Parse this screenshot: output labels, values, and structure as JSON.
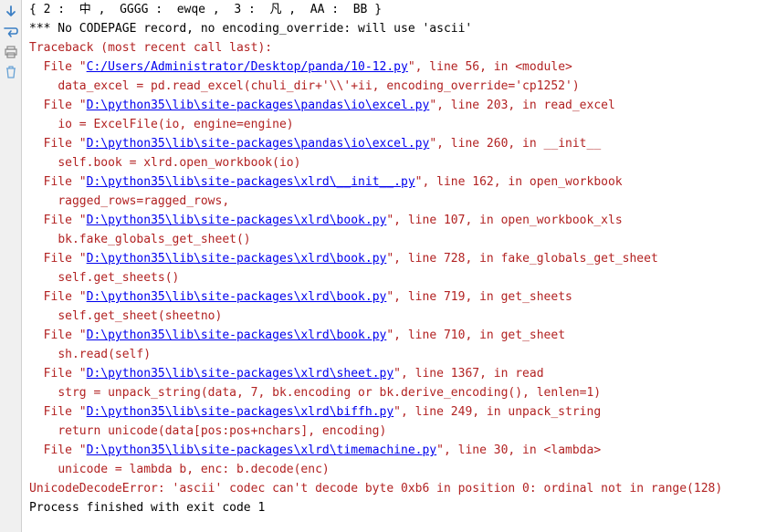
{
  "icons": {
    "down": "down-arrow-icon",
    "wrap": "wrap-icon",
    "print": "print-icon",
    "trash": "trash-icon"
  },
  "lines": [
    {
      "indent": "",
      "parts": [
        {
          "t": "{ 2 :  中 ,  GGGG :  ewqe ,  3 :  凡 ,  AA :  BB }",
          "c": ""
        }
      ]
    },
    {
      "indent": "",
      "parts": [
        {
          "t": "*** No CODEPAGE record, no encoding_override: will use 'ascii'",
          "c": ""
        }
      ]
    },
    {
      "indent": "",
      "parts": [
        {
          "t": "Traceback (most recent call last):",
          "c": "red"
        }
      ]
    },
    {
      "indent": "  ",
      "parts": [
        {
          "t": "File \"",
          "c": "red"
        },
        {
          "t": "C:/Users/Administrator/Desktop/panda/10-12.py",
          "c": "blue"
        },
        {
          "t": "\", line 56, in <module>",
          "c": "red"
        }
      ]
    },
    {
      "indent": "    ",
      "parts": [
        {
          "t": "data_excel = pd.read_excel(chuli_dir+'\\\\'+ii, encoding_override='cp1252')",
          "c": "red"
        }
      ]
    },
    {
      "indent": "  ",
      "parts": [
        {
          "t": "File \"",
          "c": "red"
        },
        {
          "t": "D:\\python35\\lib\\site-packages\\pandas\\io\\excel.py",
          "c": "blue"
        },
        {
          "t": "\", line 203, in read_excel",
          "c": "red"
        }
      ]
    },
    {
      "indent": "    ",
      "parts": [
        {
          "t": "io = ExcelFile(io, engine=engine)",
          "c": "red"
        }
      ]
    },
    {
      "indent": "  ",
      "parts": [
        {
          "t": "File \"",
          "c": "red"
        },
        {
          "t": "D:\\python35\\lib\\site-packages\\pandas\\io\\excel.py",
          "c": "blue"
        },
        {
          "t": "\", line 260, in __init__",
          "c": "red"
        }
      ]
    },
    {
      "indent": "    ",
      "parts": [
        {
          "t": "self.book = xlrd.open_workbook(io)",
          "c": "red"
        }
      ]
    },
    {
      "indent": "  ",
      "parts": [
        {
          "t": "File \"",
          "c": "red"
        },
        {
          "t": "D:\\python35\\lib\\site-packages\\xlrd\\__init__.py",
          "c": "blue"
        },
        {
          "t": "\", line 162, in open_workbook",
          "c": "red"
        }
      ]
    },
    {
      "indent": "    ",
      "parts": [
        {
          "t": "ragged_rows=ragged_rows,",
          "c": "red"
        }
      ]
    },
    {
      "indent": "  ",
      "parts": [
        {
          "t": "File \"",
          "c": "red"
        },
        {
          "t": "D:\\python35\\lib\\site-packages\\xlrd\\book.py",
          "c": "blue"
        },
        {
          "t": "\", line 107, in open_workbook_xls",
          "c": "red"
        }
      ]
    },
    {
      "indent": "    ",
      "parts": [
        {
          "t": "bk.fake_globals_get_sheet()",
          "c": "red"
        }
      ]
    },
    {
      "indent": "  ",
      "parts": [
        {
          "t": "File \"",
          "c": "red"
        },
        {
          "t": "D:\\python35\\lib\\site-packages\\xlrd\\book.py",
          "c": "blue"
        },
        {
          "t": "\", line 728, in fake_globals_get_sheet",
          "c": "red"
        }
      ]
    },
    {
      "indent": "    ",
      "parts": [
        {
          "t": "self.get_sheets()",
          "c": "red"
        }
      ]
    },
    {
      "indent": "  ",
      "parts": [
        {
          "t": "File \"",
          "c": "red"
        },
        {
          "t": "D:\\python35\\lib\\site-packages\\xlrd\\book.py",
          "c": "blue"
        },
        {
          "t": "\", line 719, in get_sheets",
          "c": "red"
        }
      ]
    },
    {
      "indent": "    ",
      "parts": [
        {
          "t": "self.get_sheet(sheetno)",
          "c": "red"
        }
      ]
    },
    {
      "indent": "  ",
      "parts": [
        {
          "t": "File \"",
          "c": "red"
        },
        {
          "t": "D:\\python35\\lib\\site-packages\\xlrd\\book.py",
          "c": "blue"
        },
        {
          "t": "\", line 710, in get_sheet",
          "c": "red"
        }
      ]
    },
    {
      "indent": "    ",
      "parts": [
        {
          "t": "sh.read(self)",
          "c": "red"
        }
      ]
    },
    {
      "indent": "  ",
      "parts": [
        {
          "t": "File \"",
          "c": "red"
        },
        {
          "t": "D:\\python35\\lib\\site-packages\\xlrd\\sheet.py",
          "c": "blue"
        },
        {
          "t": "\", line 1367, in read",
          "c": "red"
        }
      ]
    },
    {
      "indent": "    ",
      "parts": [
        {
          "t": "strg = unpack_string(data, 7, bk.encoding or bk.derive_encoding(), lenlen=1)",
          "c": "red"
        }
      ]
    },
    {
      "indent": "  ",
      "parts": [
        {
          "t": "File \"",
          "c": "red"
        },
        {
          "t": "D:\\python35\\lib\\site-packages\\xlrd\\biffh.py",
          "c": "blue"
        },
        {
          "t": "\", line 249, in unpack_string",
          "c": "red"
        }
      ]
    },
    {
      "indent": "    ",
      "parts": [
        {
          "t": "return unicode(data[pos:pos+nchars], encoding)",
          "c": "red"
        }
      ]
    },
    {
      "indent": "  ",
      "parts": [
        {
          "t": "File \"",
          "c": "red"
        },
        {
          "t": "D:\\python35\\lib\\site-packages\\xlrd\\timemachine.py",
          "c": "blue"
        },
        {
          "t": "\", line 30, in <lambda>",
          "c": "red"
        }
      ]
    },
    {
      "indent": "    ",
      "parts": [
        {
          "t": "unicode = lambda b, enc: b.decode(enc)",
          "c": "red"
        }
      ]
    },
    {
      "indent": "",
      "parts": [
        {
          "t": "UnicodeDecodeError: 'ascii' codec can't decode byte 0xb6 in position 0: ordinal not in range(128)",
          "c": "red"
        }
      ]
    },
    {
      "indent": "",
      "parts": [
        {
          "t": "",
          "c": ""
        }
      ]
    },
    {
      "indent": "",
      "parts": [
        {
          "t": "Process finished with exit code 1",
          "c": ""
        }
      ]
    }
  ]
}
